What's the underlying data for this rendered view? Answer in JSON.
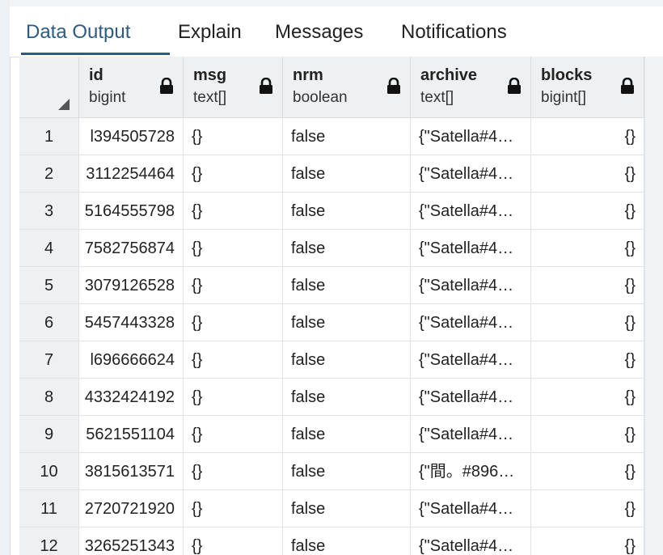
{
  "tabs": [
    {
      "label": "Data Output",
      "active": true
    },
    {
      "label": "Explain",
      "active": false
    },
    {
      "label": "Messages",
      "active": false
    },
    {
      "label": "Notifications",
      "active": false
    }
  ],
  "columns": [
    {
      "name": "id",
      "type": "bigint"
    },
    {
      "name": "msg",
      "type": "text[]"
    },
    {
      "name": "nrm",
      "type": "boolean"
    },
    {
      "name": "archive",
      "type": "text[]"
    },
    {
      "name": "blocks",
      "type": "bigint[]"
    }
  ],
  "rows": [
    {
      "num": "1",
      "id": "l394505728",
      "msg": "{}",
      "nrm": "false",
      "archive": "{\"Satella#4…",
      "blocks": "{}"
    },
    {
      "num": "2",
      "id": "3112254464",
      "msg": "{}",
      "nrm": "false",
      "archive": "{\"Satella#4…",
      "blocks": "{}"
    },
    {
      "num": "3",
      "id": "5164555798",
      "msg": "{}",
      "nrm": "false",
      "archive": "{\"Satella#4…",
      "blocks": "{}"
    },
    {
      "num": "4",
      "id": "7582756874",
      "msg": "{}",
      "nrm": "false",
      "archive": "{\"Satella#4…",
      "blocks": "{}"
    },
    {
      "num": "5",
      "id": "3079126528",
      "msg": "{}",
      "nrm": "false",
      "archive": "{\"Satella#4…",
      "blocks": "{}"
    },
    {
      "num": "6",
      "id": "5457443328",
      "msg": "{}",
      "nrm": "false",
      "archive": "{\"Satella#4…",
      "blocks": "{}"
    },
    {
      "num": "7",
      "id": "l696666624",
      "msg": "{}",
      "nrm": "false",
      "archive": "{\"Satella#4…",
      "blocks": "{}"
    },
    {
      "num": "8",
      "id": "4332424192",
      "msg": "{}",
      "nrm": "false",
      "archive": "{\"Satella#4…",
      "blocks": "{}"
    },
    {
      "num": "9",
      "id": "5621551104",
      "msg": "{}",
      "nrm": "false",
      "archive": "{\"Satella#4…",
      "blocks": "{}"
    },
    {
      "num": "10",
      "id": "3815613571",
      "msg": "{}",
      "nrm": "false",
      "archive": "{\"間。#896…",
      "blocks": "{}"
    },
    {
      "num": "11",
      "id": "2720721920",
      "msg": "{}",
      "nrm": "false",
      "archive": "{\"Satella#4…",
      "blocks": "{}"
    },
    {
      "num": "12",
      "id": "3265251343",
      "msg": "{}",
      "nrm": "false",
      "archive": "{\"Satella#4…",
      "blocks": "{}"
    }
  ],
  "colors": {
    "accent": "#2b5b86",
    "header_bg": "#eef0f2",
    "grid_line": "#dfe3e7"
  }
}
